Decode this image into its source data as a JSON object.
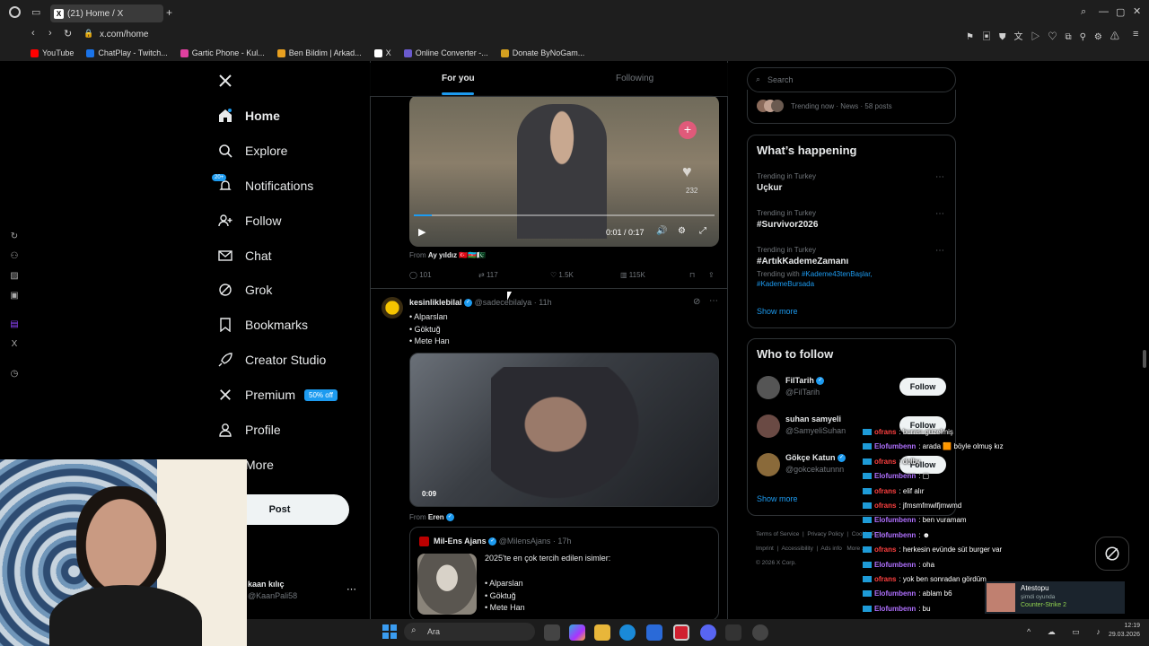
{
  "browser": {
    "tab_title": "(21) Home / X",
    "url": "x.com/home",
    "bookmarks": [
      {
        "label": "YouTube",
        "color": "#ff0000"
      },
      {
        "label": "ChatPlay - Twitch...",
        "color": "#1a73e8"
      },
      {
        "label": "Gartic Phone - Kul...",
        "color": "#e040a0"
      },
      {
        "label": "Ben Bildim | Arkad...",
        "color": "#e8a020"
      },
      {
        "label": "X",
        "color": "#ffffff"
      },
      {
        "label": "Online Converter -...",
        "color": "#6a5acd"
      },
      {
        "label": "Donate ByNoGam...",
        "color": "#d4a020"
      }
    ]
  },
  "nav": {
    "home": "Home",
    "explore": "Explore",
    "notifications": "Notifications",
    "notif_badge": "20+",
    "follow": "Follow",
    "chat": "Chat",
    "grok": "Grok",
    "bookmarks": "Bookmarks",
    "creator_studio": "Creator Studio",
    "premium": "Premium",
    "premium_badge": "50% off",
    "profile": "Profile",
    "more": "More",
    "post": "Post",
    "user_name": "kaan kılıç",
    "user_handle": "@KaanPali58"
  },
  "feed": {
    "tab_for_you": "For you",
    "tab_following": "Following",
    "video1": {
      "time": "0:01 / 0:17",
      "like_count": "232",
      "from_label": "From",
      "from_name": "Ay yıldız",
      "replies": "101",
      "reposts": "117",
      "likes": "1.5K",
      "views": "115K",
      "progress": 0.06
    },
    "tweet2": {
      "name": "kesinliklebilal",
      "handle": "@sadecebilalya",
      "time": "· 11h",
      "lines": [
        "• Alparslan",
        "• Göktuğ",
        "• Mete Han"
      ],
      "video_time": "0:09",
      "from_label": "From",
      "from_name": "Eren"
    },
    "quote": {
      "name": "Mil-Ens Ajans",
      "handle": "@MilensAjans",
      "time": "· 17h",
      "headline": "2025'te en çok tercih edilen isimler:",
      "lines": [
        "• Alparslan",
        "• Göktuğ",
        "• Mete Han"
      ]
    }
  },
  "right": {
    "search_placeholder": "Search",
    "trending_meta": "Trending now · News · 58 posts",
    "happening_title": "What’s happening",
    "trends": [
      {
        "cat": "Trending in Turkey",
        "name": "Uçkur"
      },
      {
        "cat": "Trending in Turkey",
        "name": "#Survivor2026"
      },
      {
        "cat": "Trending in Turkey",
        "name": "#ArtıkKademeZamanı",
        "with_label": "Trending with",
        "with_tags": "#Kademe43tenBaşlar,",
        "with_tags2": "#KademeBursada"
      }
    ],
    "show_more": "Show more",
    "who_title": "Who to follow",
    "follow_list": [
      {
        "name": "FilTarih",
        "handle": "@FilTarih"
      },
      {
        "name": "suhan samyeli",
        "handle": "@SamyeliSuhan"
      },
      {
        "name": "Gökçe Katun",
        "handle": "@gokcekatunnn"
      }
    ],
    "follow_label": "Follow",
    "show_more2": "Show more",
    "footer": [
      "Terms of Service",
      "Privacy Policy",
      "Cookie Policy",
      "Imprint",
      "Accessibility",
      "Ads info",
      "More ...",
      "© 2026 X Corp."
    ]
  },
  "chat": [
    {
      "user": "ofrans",
      "color": "#ff4040",
      "msg": ": burası güzelmiş"
    },
    {
      "user": "Elofumbenn",
      "color": "#b070ff",
      "msg": ": arada 🟧 böyle olmuş kız"
    },
    {
      "user": "ofrans",
      "color": "#ff4040",
      "msg": ": dolby"
    },
    {
      "user": "Elofumbenn",
      "color": "#b070ff",
      "msg": ": ▢"
    },
    {
      "user": "ofrans",
      "color": "#ff4040",
      "msg": ": elif alır"
    },
    {
      "user": "ofrans",
      "color": "#ff4040",
      "msg": ": jfmsmfmwlfjmwmd"
    },
    {
      "user": "Elofumbenn",
      "color": "#b070ff",
      "msg": ": ben vuramam"
    },
    {
      "user": "Elofumbenn",
      "color": "#b070ff",
      "msg": ": ☻"
    },
    {
      "user": "ofrans",
      "color": "#ff4040",
      "msg": ": herkesin evünde süt burger var"
    },
    {
      "user": "Elofumbenn",
      "color": "#b070ff",
      "msg": ": oha"
    },
    {
      "user": "ofrans",
      "color": "#ff4040",
      "msg": ": yok ben sonradan gördüm"
    },
    {
      "user": "Elofumbenn",
      "color": "#b070ff",
      "msg": ": ablam b6"
    },
    {
      "user": "Elofumbenn",
      "color": "#b070ff",
      "msg": ": bu"
    },
    {
      "user": "ofrans",
      "color": "#ff4040",
      "msg": ": jfjsjmfsmfsmfmw"
    },
    {
      "user": "Elofumbenn",
      "color": "#b070ff",
      "msg": ": nzmsöalaaksnsn"
    }
  ],
  "steam_toast": {
    "name": "Atestopu",
    "status": "şimdi oyunda",
    "game": "Counter-Strike 2"
  },
  "taskbar": {
    "search_placeholder": "Ara",
    "time": "12:19",
    "date": "29.03.2026"
  }
}
